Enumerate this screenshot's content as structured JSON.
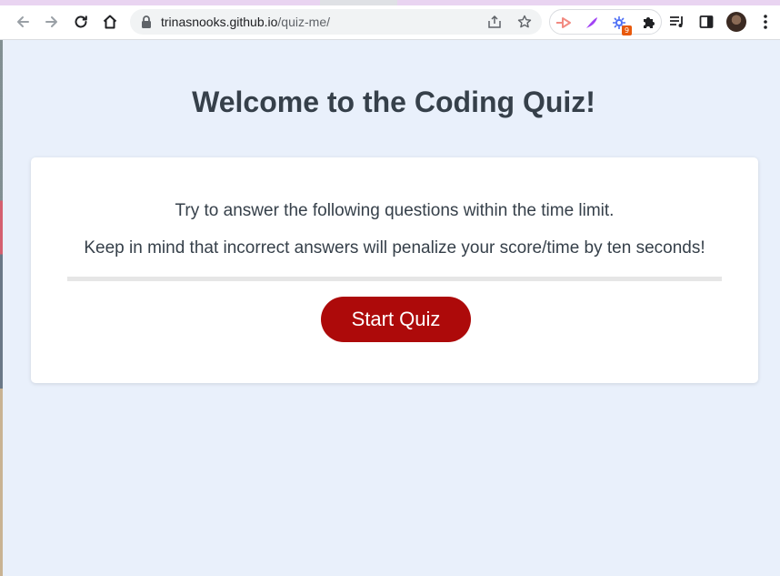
{
  "browser": {
    "url_host": "trinasnooks.github.io",
    "url_path": "/quiz-me/",
    "extension_badge": "9",
    "icons": {
      "back": "back-arrow-icon",
      "forward": "forward-arrow-icon",
      "reload": "reload-icon",
      "home": "home-icon",
      "lock": "lock-icon",
      "share": "share-icon",
      "bookmark": "star-icon",
      "extensions": [
        "cast-extension-icon",
        "quill-extension-icon",
        "sparkle-extension-icon",
        "puzzle-extensions-icon"
      ],
      "reading_list": "reading-list-icon",
      "side_panel": "side-panel-icon",
      "profile": "profile-avatar",
      "menu": "kebab-menu-icon"
    }
  },
  "page": {
    "title": "Welcome to the Coding Quiz!",
    "instructions": [
      "Try to answer the following questions within the time limit.",
      "Keep in mind that incorrect answers will penalize your score/time by ten seconds!"
    ],
    "start_button": "Start Quiz"
  },
  "colors": {
    "background": "#e9f0fb",
    "card": "#ffffff",
    "title_text": "#36404a",
    "button": "#ad0a0a",
    "button_text": "#ffffff",
    "divider": "#e6e6e6"
  }
}
